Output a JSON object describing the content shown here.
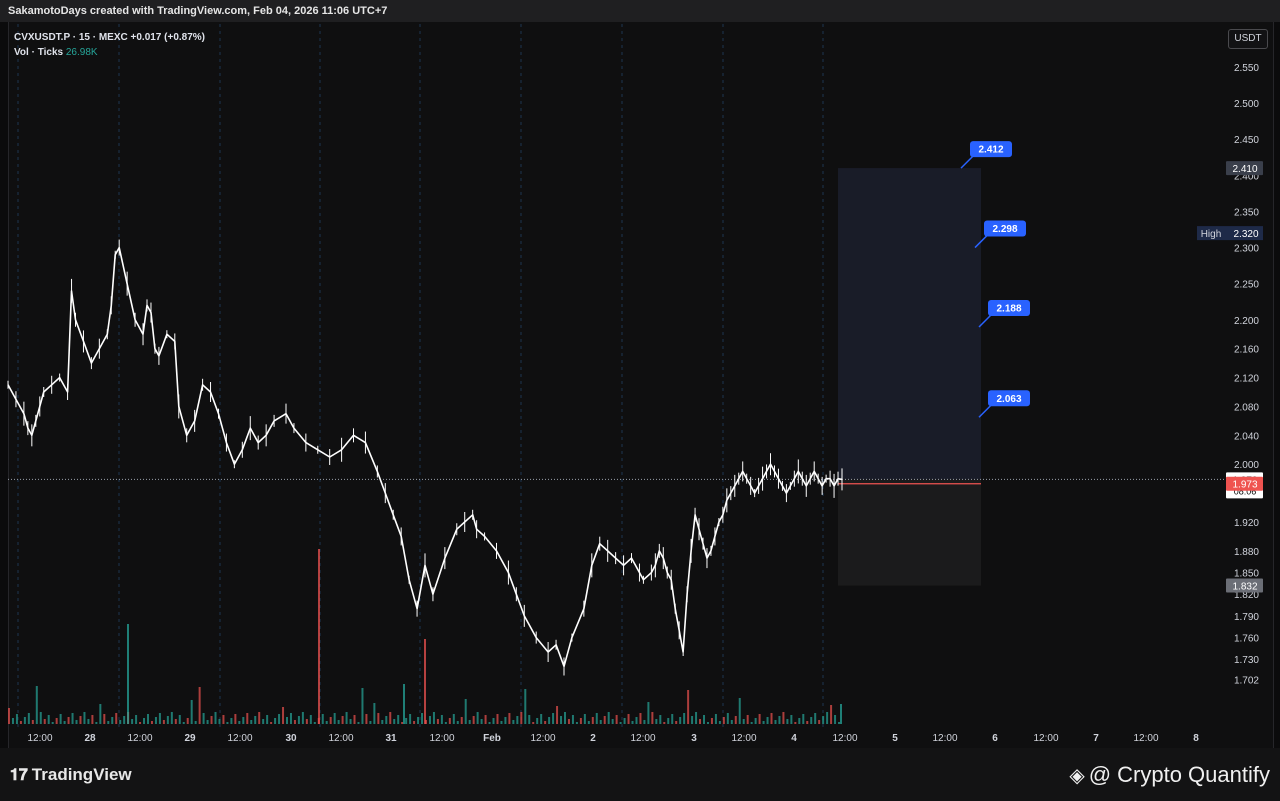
{
  "header": {
    "title": "SakamotoDays created with TradingView.com, Feb 04, 2026 11:06 UTC+7"
  },
  "legend": {
    "symbol_line": "CVXUSDT.P · 15 · MEXC  +0.017 (+0.87%)",
    "vol_label": "Vol · Ticks",
    "vol_value": "26.98K"
  },
  "unit_button": "USDT",
  "footer": {
    "logo_text": "TradingView",
    "brand_text": "@ Crypto Quantify"
  },
  "colors": {
    "up": "#26a69a",
    "down": "#ef5350",
    "label_blue": "#2962ff",
    "candle": "#ffffff",
    "bg": "#0f0f10"
  },
  "chart_data": {
    "type": "line",
    "title": "CVXUSDT.P 15m",
    "xlabel": "",
    "ylabel": "",
    "ylim": [
      1.7,
      2.58
    ],
    "y_ticks": [
      "2.550",
      "2.500",
      "2.450",
      "2.400",
      "2.350",
      "2.300",
      "2.250",
      "2.200",
      "2.160",
      "2.120",
      "2.080",
      "2.040",
      "2.000",
      "1.960",
      "1.920",
      "1.880",
      "1.850",
      "1.820",
      "1.790",
      "1.760",
      "1.730",
      "1.702"
    ],
    "x_ticks": [
      "12:00",
      "28",
      "12:00",
      "29",
      "12:00",
      "30",
      "12:00",
      "31",
      "12:00",
      "Feb",
      "12:00",
      "2",
      "12:00",
      "3",
      "12:00",
      "4",
      "12:00",
      "5",
      "12:00",
      "6",
      "12:00",
      "7",
      "12:00",
      "8"
    ],
    "series": [
      {
        "name": "CVXUSDT.P",
        "x": [
          0,
          2,
          4,
          5,
          6,
          7,
          8,
          9,
          11,
          13,
          15,
          16,
          17,
          19,
          21,
          23,
          25,
          26,
          27,
          28,
          30,
          32,
          34,
          35,
          36,
          37,
          38,
          40,
          42,
          43,
          45,
          47,
          49,
          51,
          53,
          55,
          57,
          59,
          61,
          63,
          65,
          67,
          70,
          72,
          75,
          78,
          81,
          84,
          87,
          90,
          93,
          95,
          97,
          99,
          101,
          103,
          105,
          107,
          110,
          113,
          115,
          117,
          118,
          120,
          123,
          126,
          128,
          130,
          133,
          136,
          138,
          140,
          142,
          145,
          147,
          149,
          151,
          153,
          155,
          157,
          159,
          160,
          162,
          163,
          164,
          165,
          166,
          167,
          168,
          169,
          170,
          171,
          172,
          173,
          174,
          175,
          176,
          177,
          178,
          179,
          180,
          181,
          182,
          183,
          184,
          185,
          186,
          187,
          188,
          189,
          190,
          191,
          192,
          193,
          194,
          195,
          196,
          197,
          198,
          199,
          200,
          201,
          202,
          203,
          204,
          205,
          206,
          207,
          208,
          209,
          210
        ],
        "values": [
          2.11,
          2.09,
          2.07,
          2.05,
          2.04,
          2.06,
          2.08,
          2.1,
          2.11,
          2.12,
          2.1,
          2.24,
          2.2,
          2.17,
          2.14,
          2.16,
          2.18,
          2.22,
          2.29,
          2.3,
          2.25,
          2.2,
          2.18,
          2.22,
          2.21,
          2.16,
          2.15,
          2.18,
          2.17,
          2.08,
          2.04,
          2.06,
          2.11,
          2.1,
          2.07,
          2.03,
          2.0,
          2.02,
          2.05,
          2.03,
          2.04,
          2.06,
          2.07,
          2.05,
          2.03,
          2.02,
          2.01,
          2.02,
          2.04,
          2.03,
          1.99,
          1.96,
          1.93,
          1.9,
          1.84,
          1.8,
          1.86,
          1.82,
          1.87,
          1.91,
          1.92,
          1.93,
          1.91,
          1.9,
          1.88,
          1.85,
          1.82,
          1.79,
          1.76,
          1.74,
          1.75,
          1.72,
          1.76,
          1.8,
          1.86,
          1.89,
          1.88,
          1.87,
          1.86,
          1.87,
          1.85,
          1.84,
          1.85,
          1.86,
          1.88,
          1.87,
          1.85,
          1.84,
          1.8,
          1.77,
          1.74,
          1.82,
          1.88,
          1.93,
          1.91,
          1.89,
          1.87,
          1.88,
          1.9,
          1.92,
          1.93,
          1.95,
          1.96,
          1.97,
          1.98,
          1.99,
          1.98,
          1.97,
          1.96,
          1.97,
          1.98,
          1.99,
          2.0,
          1.99,
          1.98,
          1.97,
          1.96,
          1.97,
          1.98,
          1.99,
          1.98,
          1.97,
          1.98,
          1.99,
          1.98,
          1.97,
          1.98,
          1.98,
          1.97,
          1.98,
          1.979
        ]
      }
    ],
    "last_price": 1.979,
    "countdown": "08:06",
    "prev_label": 1.973,
    "stop_label": 1.832,
    "top_label": 2.41,
    "high_label": 2.32,
    "high_text": "High",
    "targets": [
      {
        "label": "2.412",
        "y": 2.41
      },
      {
        "label": "2.298",
        "y": 2.3
      },
      {
        "label": "2.188",
        "y": 2.19
      },
      {
        "label": "2.063",
        "y": 2.065
      }
    ],
    "grid": "vertical",
    "legend_position": "top-left"
  }
}
